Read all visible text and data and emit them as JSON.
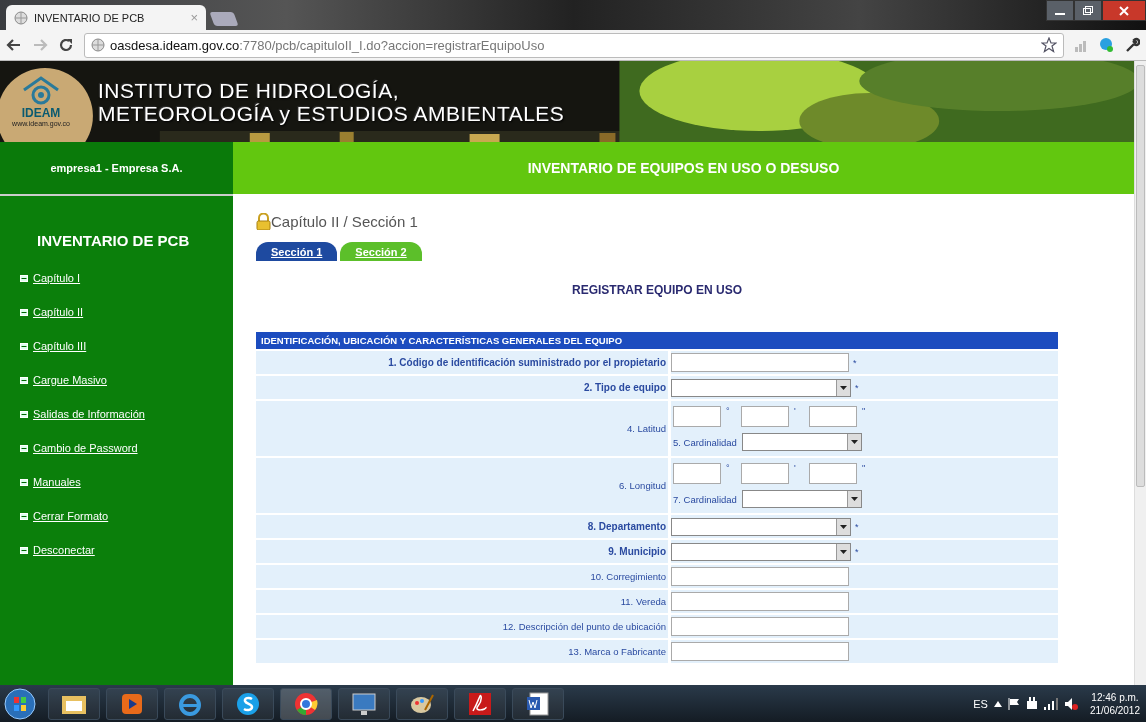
{
  "browser": {
    "tab_title": "INVENTARIO DE PCB",
    "tab_close": "×",
    "url_host": "oasdesa.ideam.gov.co",
    "url_path": ":7780/pcb/capituloII_I.do?accion=registrarEquipoUso"
  },
  "banner": {
    "logo_text": "IDEAM",
    "logo_url": "www.ideam.gov.co",
    "title_line1": "INSTITUTO DE HIDROLOGÍA,",
    "title_line2": "METEOROLOGÍA y ESTUDIOS AMBIENTALES"
  },
  "header": {
    "user": "empresa1 - Empresa S.A.",
    "title": "INVENTARIO DE EQUIPOS EN USO O DESUSO"
  },
  "sidebar": {
    "title": "INVENTARIO DE PCB",
    "items": [
      {
        "label": "Capítulo I"
      },
      {
        "label": "Capítulo II"
      },
      {
        "label": "Capítulo III"
      },
      {
        "label": "Cargue Masivo"
      },
      {
        "label": "Salidas de Información"
      },
      {
        "label": "Cambio de Password"
      },
      {
        "label": "Manuales"
      },
      {
        "label": "Cerrar Formato"
      },
      {
        "label": "Desconectar"
      }
    ]
  },
  "breadcrumb": "Capítulo II / Sección 1",
  "tabs": [
    {
      "label": "Sección 1",
      "selected": true
    },
    {
      "label": "Sección 2",
      "selected": false
    }
  ],
  "form_title": "REGISTRAR EQUIPO EN USO",
  "section_title": "IDENTIFICACIÓN, UBICACIÓN Y CARACTERÍSTICAS GENERALES DEL EQUIPO",
  "rows": [
    {
      "kind": "text",
      "label": "1. Código de identificación suministrado por el propietario",
      "required": true,
      "mark": "*"
    },
    {
      "kind": "select",
      "label": "2. Tipo de equipo",
      "required": true,
      "mark": "*"
    },
    {
      "kind": "coords",
      "label": "4. Latitud",
      "required": false,
      "units": [
        "°",
        "'",
        "\""
      ],
      "sublabel": "5. Cardinalidad"
    },
    {
      "kind": "coords",
      "label": "6. Longitud",
      "required": false,
      "units": [
        "°",
        "'",
        "\""
      ],
      "sublabel": "7. Cardinalidad"
    },
    {
      "kind": "select",
      "label": "8. Departamento",
      "required": true,
      "mark": "*"
    },
    {
      "kind": "select",
      "label": "9. Municipio",
      "required": true,
      "mark": "*"
    },
    {
      "kind": "text",
      "label": "10. Corregimiento",
      "required": false
    },
    {
      "kind": "text",
      "label": "11. Vereda",
      "required": false
    },
    {
      "kind": "text",
      "label": "12. Descripción del punto de ubicación",
      "required": false
    },
    {
      "kind": "text",
      "label": "13. Marca o Fabricante",
      "required": false
    }
  ],
  "taskbar": {
    "language": "ES",
    "time": "12:46 p.m.",
    "date": "21/06/2012"
  }
}
